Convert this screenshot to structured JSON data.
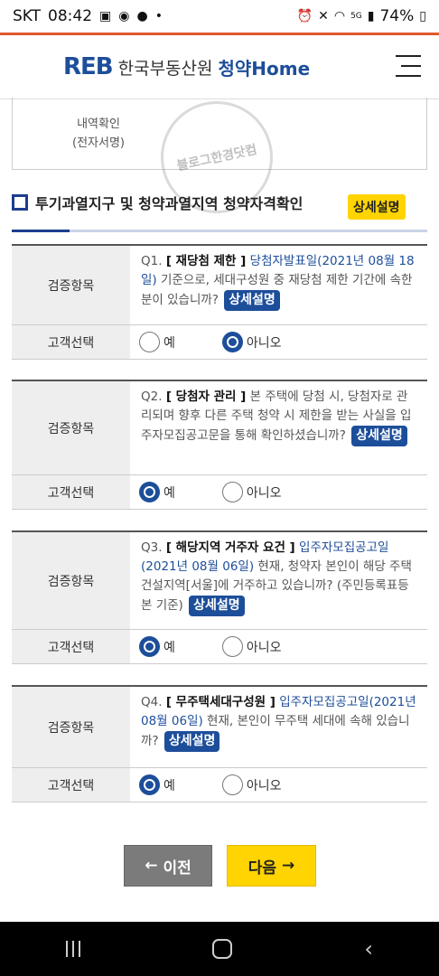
{
  "status_bar": {
    "carrier": "SKT",
    "time": "08:42",
    "battery": "74%",
    "network": "5G"
  },
  "header": {
    "logo_mark": "REB",
    "org_name": "한국부동산원",
    "home_name": "청약Home"
  },
  "prev_card": {
    "cell_label_lines": [
      "내역확인",
      "(전자서명)"
    ]
  },
  "watermark_text": "블로그한경닷컴",
  "section": {
    "title": "투기과열지구 및 청약과열지역 청약자격확인",
    "detail_button": "상세설명"
  },
  "labels": {
    "verify": "검증항목",
    "choice": "고객선택",
    "yes": "예",
    "no": "아니오"
  },
  "questions": [
    {
      "num": "Q1.",
      "title": "[ 재당첨 제한 ]",
      "link": "당첨자발표일(2021년 08월 18일)",
      "text": " 기준으로, 세대구성원 중 재당첨 제한 기간에 속한 분이 있습니까?",
      "pill": "상세설명",
      "selected": "no"
    },
    {
      "num": "Q2.",
      "title": "[ 당첨자 관리 ]",
      "link": "",
      "text": " 본 주택에 당첨 시, 당첨자로 관리되며 향후 다른 주택 청약 시 제한을 받는 사실을 입주자모집공고문을 통해 확인하셨습니까?",
      "pill": "상세설명",
      "selected": "yes"
    },
    {
      "num": "Q3.",
      "title": "[ 해당지역 거주자 요건 ]",
      "link": "입주자모집공고일(2021년 08월 06일)",
      "text": " 현재, 청약자 본인이 해당 주택건설지역[서울]에 거주하고 있습니까? (주민등록표등본 기준)",
      "pill": "상세설명",
      "selected": "yes"
    },
    {
      "num": "Q4.",
      "title": "[ 무주택세대구성원 ]",
      "link": "입주자모집공고일(2021년 08월 06일)",
      "text": " 현재, 본인이 무주택 세대에 속해 있습니까?",
      "pill": "상세설명",
      "selected": "yes"
    }
  ],
  "nav": {
    "prev": "이전",
    "next": "다음"
  }
}
